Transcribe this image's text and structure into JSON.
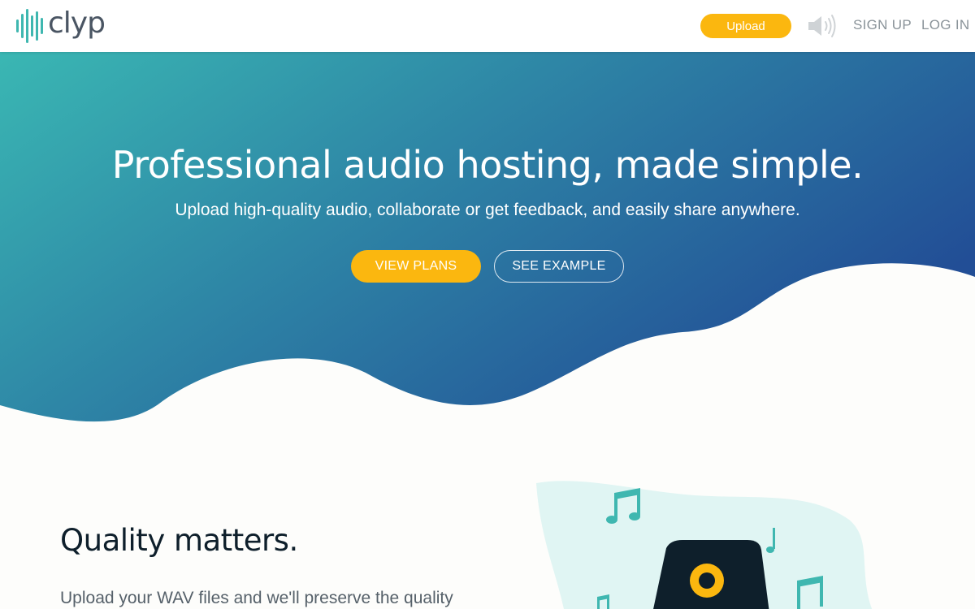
{
  "header": {
    "logo_text": "clyp",
    "upload_label": "Upload",
    "signup_label": "SIGN UP",
    "login_label": "LOG IN",
    "speaker_icon": "speaker-icon"
  },
  "hero": {
    "title": "Professional audio hosting, made simple.",
    "subtitle": "Upload high-quality audio, collaborate or get feedback, and easily share anywhere.",
    "view_plans_label": "VIEW PLANS",
    "see_example_label": "SEE EXAMPLE"
  },
  "quality": {
    "title": "Quality matters.",
    "text": "Upload your WAV files and we'll preserve the quality"
  },
  "colors": {
    "brand_teal": "#3fb7b0",
    "hero_gradient_start": "#3ab7b3",
    "hero_gradient_end": "#224e96",
    "accent_yellow": "#fbb70f",
    "dark_navy": "#0e1f2b"
  }
}
